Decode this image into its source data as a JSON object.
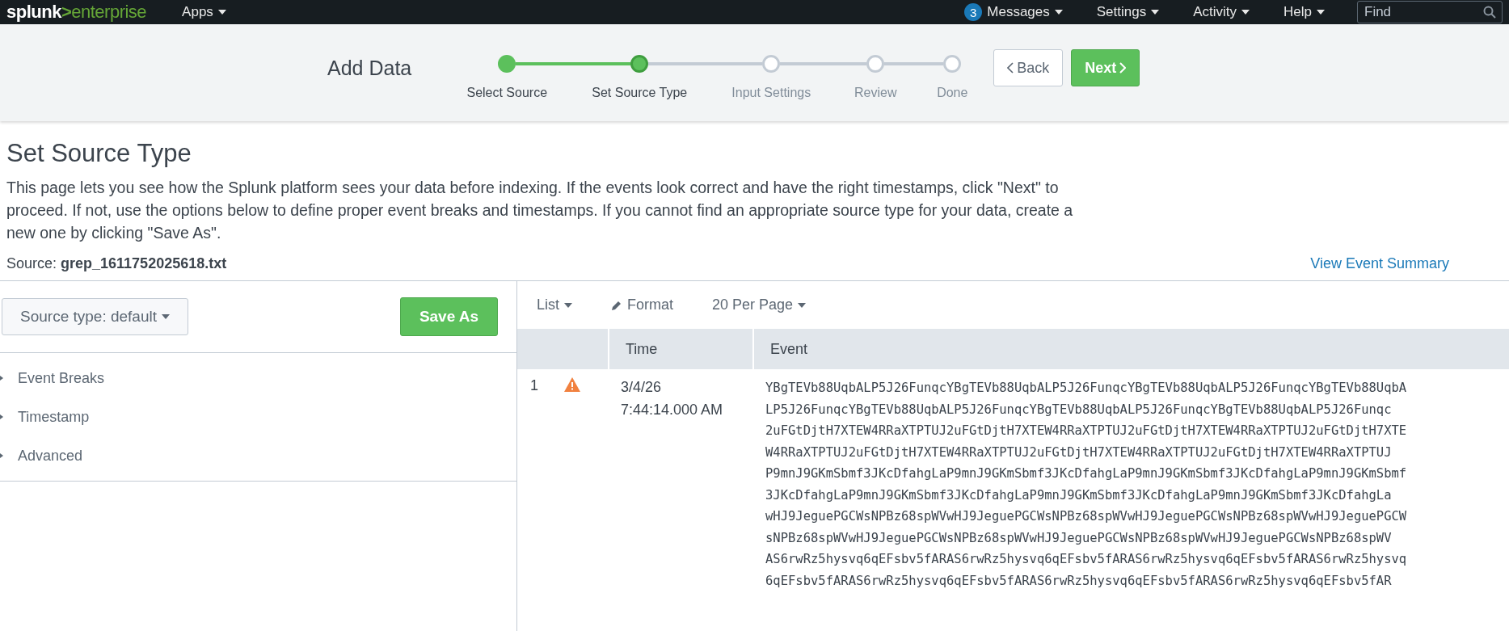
{
  "nav": {
    "logo": {
      "brand": "splunk",
      "mark": ">",
      "product": "enterprise"
    },
    "menus_left": [
      {
        "label": "Apps"
      }
    ],
    "menus_right": [
      {
        "label": "Messages",
        "badge": "3"
      },
      {
        "label": "Settings"
      },
      {
        "label": "Activity"
      },
      {
        "label": "Help"
      }
    ],
    "search": {
      "placeholder": "Find"
    }
  },
  "wizard": {
    "title": "Add Data",
    "steps": [
      {
        "label": "Select Source",
        "completed": true,
        "selected": false
      },
      {
        "label": "Set Source Type",
        "completed": false,
        "selected": true
      },
      {
        "label": "Input Settings",
        "completed": false,
        "selected": false
      },
      {
        "label": "Review",
        "completed": false,
        "selected": false
      },
      {
        "label": "Done",
        "completed": false,
        "selected": false
      }
    ],
    "back_button": "Back",
    "next_button": "Next"
  },
  "page": {
    "title": "Set Source Type",
    "description": "This page lets you see how the Splunk platform sees your data before indexing. If the events look correct and have the right timestamps, click \"Next\" to proceed. If not, use the options below to define proper event breaks and timestamps. If you cannot find an appropriate source type for your data, create a new one by clicking \"Save As\".",
    "source": "Source: **grep_1611752025618.txt**",
    "summary_link": "View Event Summary"
  },
  "settings_panel": {
    "sourcetype_button": "Source type: default",
    "save_button": "Save As",
    "sections": [
      {
        "label": "Event Breaks",
        "expanded": false
      },
      {
        "label": "Timestamp",
        "expanded": false
      },
      {
        "label": "Advanced",
        "expanded": false
      }
    ]
  },
  "events": {
    "toolbar": {
      "view_menu": "List",
      "format_button": "Format",
      "per_page_menu": "20 Per Page"
    },
    "table": {
      "columns": [
        "Time",
        "Event"
      ],
      "rows": [
        {
          "number": "1",
          "warning": true,
          "date": "3/4/26",
          "time": "7:44:14.000 AM",
          "event": "YBgTEVb88UqbALP5J26FunqcYBgTEVb88UqbALP5J26FunqcYBgTEVb88UqbALP5J26FunqcYBgTEVb88UqbALP5J26FunqcYBgTEVb88UqbALP5J26FunqcYBgTEVb88UqbALP5J26FunqcYBgTEVb88UqbALP5J26Funqc\n2uFGtDjtH7XTEW4RRaXTPTUJ2uFGtDjtH7XTEW4RRaXTPTUJ2uFGtDjtH7XTEW4RRaXTPTUJ2uFGtDjtH7XTEW4RRaXTPTUJ2uFGtDjtH7XTEW4RRaXTPTUJ2uFGtDjtH7XTEW4RRaXTPTUJ2uFGtDjtH7XTEW4RRaXTPTUJ\nP9mnJ9GKmSbmf3JKcDfahgLaP9mnJ9GKmSbmf3JKcDfahgLaP9mnJ9GKmSbmf3JKcDfahgLaP9mnJ9GKmSbmf3JKcDfahgLaP9mnJ9GKmSbmf3JKcDfahgLaP9mnJ9GKmSbmf3JKcDfahgLaP9mnJ9GKmSbmf3JKcDfahgLa\nwHJ9JeguePGCWsNPBz68spWVwHJ9JeguePGCWsNPBz68spWVwHJ9JeguePGCWsNPBz68spWVwHJ9JeguePGCWsNPBz68spWVwHJ9JeguePGCWsNPBz68spWVwHJ9JeguePGCWsNPBz68spWVwHJ9JeguePGCWsNPBz68spWV\nAS6rwRz5hysvq6qEFsbv5fARAS6rwRz5hysvq6qEFsbv5fARAS6rwRz5hysvq6qEFsbv5fARAS6rwRz5hysvq6qEFsbv5fARAS6rwRz5hysvq6qEFsbv5fARAS6rwRz5hysvq6qEFsbv5fARAS6rwRz5hysvq6qEFsbv5fAR"
        }
      ]
    }
  }
}
